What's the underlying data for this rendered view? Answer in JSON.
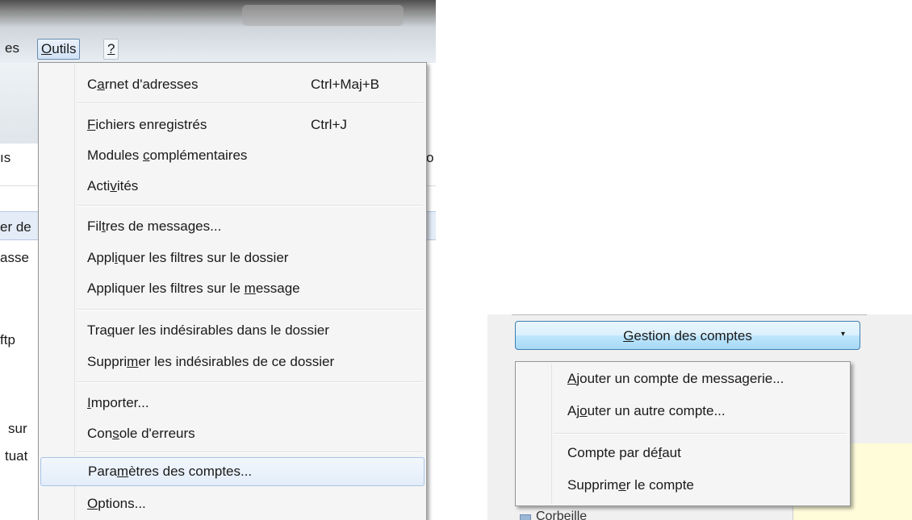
{
  "menubar": {
    "cut_label": "es",
    "outils": {
      "mnemonic": "O",
      "rest": "utils"
    },
    "help": "?"
  },
  "background_fragments": [
    "ıs",
    "er de",
    "asse",
    "ftp",
    "sur",
    "tuat"
  ],
  "background_right_fragment": "o",
  "outils_menu": {
    "items": [
      {
        "pre": "C",
        "key": "a",
        "post": "rnet d'adresses",
        "shortcut": "Ctrl+Maj+B"
      },
      {
        "pre": "",
        "key": "F",
        "post": "ichiers enregistrés",
        "shortcut": "Ctrl+J"
      },
      {
        "pre": "Modules ",
        "key": "c",
        "post": "omplémentaires",
        "shortcut": ""
      },
      {
        "pre": "Acti",
        "key": "v",
        "post": "ités",
        "shortcut": ""
      },
      {
        "pre": "Fil",
        "key": "t",
        "post": "res de messages...",
        "shortcut": ""
      },
      {
        "pre": "Appl",
        "key": "i",
        "post": "quer les filtres sur le dossier",
        "shortcut": ""
      },
      {
        "pre": "Appliquer les filtres sur le ",
        "key": "m",
        "post": "essage",
        "shortcut": ""
      },
      {
        "pre": "Tra",
        "key": "q",
        "post": "uer les indésirables dans le dossier",
        "shortcut": ""
      },
      {
        "pre": "Suppri",
        "key": "m",
        "post": "er les indésirables de ce dossier",
        "shortcut": ""
      },
      {
        "pre": "",
        "key": "I",
        "post": "mporter...",
        "shortcut": ""
      },
      {
        "pre": "Con",
        "key": "s",
        "post": "ole d'erreurs",
        "shortcut": ""
      },
      {
        "pre": "Para",
        "key": "m",
        "post": "ètres des comptes...",
        "shortcut": ""
      },
      {
        "pre": "",
        "key": "O",
        "post": "ptions...",
        "shortcut": ""
      }
    ]
  },
  "accounts_button": {
    "pre": "",
    "key": "G",
    "post": "estion des comptes",
    "caret": "▾"
  },
  "accounts_menu": {
    "items": [
      {
        "pre": "",
        "key": "A",
        "post": "jouter un compte de messagerie..."
      },
      {
        "pre": "Aj",
        "key": "o",
        "post": "uter un autre compte..."
      },
      {
        "pre": "Compte par dé",
        "key": "f",
        "post": "aut"
      },
      {
        "pre": "Supprim",
        "key": "e",
        "post": "r le compte"
      }
    ]
  },
  "folder_fragment": "Corbeille"
}
